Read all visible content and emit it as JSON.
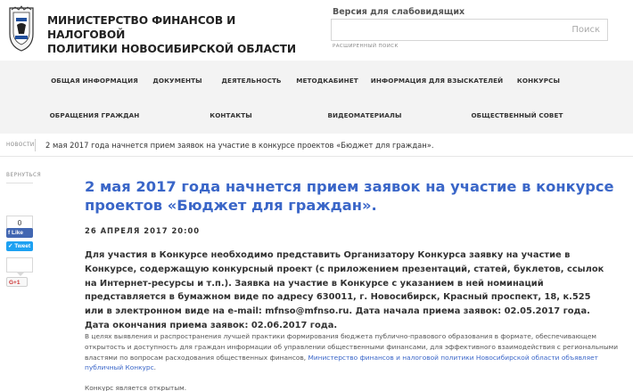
{
  "header": {
    "org_name_line1": "МИНИСТЕРСТВО ФИНАНСОВ И НАЛОГОВОЙ",
    "org_name_line2": "ПОЛИТИКИ НОВОСИБИРСКОЙ ОБЛАСТИ",
    "vision_link": "Версия для слабовидящих",
    "search_label": "Поиск",
    "search_value": "",
    "advanced_search": "РАСШИРЕННЫЙ ПОИСК",
    "logo_icon": "novosibirsk-coat-of-arms"
  },
  "nav": {
    "items": [
      {
        "label": "ОБЩАЯ ИНФОРМАЦИЯ"
      },
      {
        "label": "ДОКУМЕНТЫ"
      },
      {
        "label": "ДЕЯТЕЛЬНОСТЬ"
      },
      {
        "label": "МЕТОДКАБИНЕТ"
      },
      {
        "label": "ИНФОРМАЦИЯ ДЛЯ ВЗЫСКАТЕЛЕЙ"
      },
      {
        "label": "КОНКУРСЫ"
      },
      {
        "label": "ОБРАЩЕНИЯ ГРАЖДАН"
      },
      {
        "label": "КОНТАКТЫ"
      },
      {
        "label": "ВИДЕОМАТЕРИАЛЫ"
      },
      {
        "label": "ОБЩЕСТВЕННЫЙ СОВЕТ"
      }
    ]
  },
  "breadcrumb": {
    "parent": "НОВОСТИ",
    "current": "2 мая 2017 года начнется прием заявок на участие в конкурсе проектов «Бюджет для граждан»."
  },
  "sidebar": {
    "back": "ВЕРНУТЬСЯ",
    "facebook_count": "0",
    "facebook_label": "Like",
    "twitter_label": "Tweet",
    "gplus_label": "G+1"
  },
  "article": {
    "title": "2 мая 2017 года начнется прием заявок на участие в конкурсе проектов «Бюджет для граждан».",
    "date": "26 АПРЕЛЯ 2017 20:00",
    "lead": "Для участия в Конкурсе необходимо представить Организатору Конкурса заявку на участие в Конкурсе, содержащую конкурсный проект (с приложением презентаций, статей, буклетов, ссылок на Интернет-ресурсы и т.п.). Заявка на участие в Конкурсе с указанием в ней номинаций представляется в бумажном виде по адресу 630011, г. Новосибирск, Красный проспект, 18, к.525 или в электронном виде на e-mail: mfnso@mfnso.ru. Дата начала приема заявок: 02.05.2017 года. Дата окончания приема заявок: 02.06.2017 года.",
    "body_before_link": "В целях выявления и распространения лучшей практики формирования бюджета публично-правового образования в формате, обеспечивающем открытость и доступность для граждан информации об управлении общественными финансами, для эффективного взаимодействия с региональными властями по вопросам расходования общественных финансов, ",
    "body_link": "Министерство финансов и налоговой политики Новосибирской области объявляет публичный Конкурс",
    "body_after_link": ".",
    "body_2": "Конкурс является открытым."
  },
  "colors": {
    "accent": "#3a66c8",
    "nav_bg": "#f3f3f3",
    "facebook": "#4267b2",
    "twitter": "#1da1f2"
  }
}
